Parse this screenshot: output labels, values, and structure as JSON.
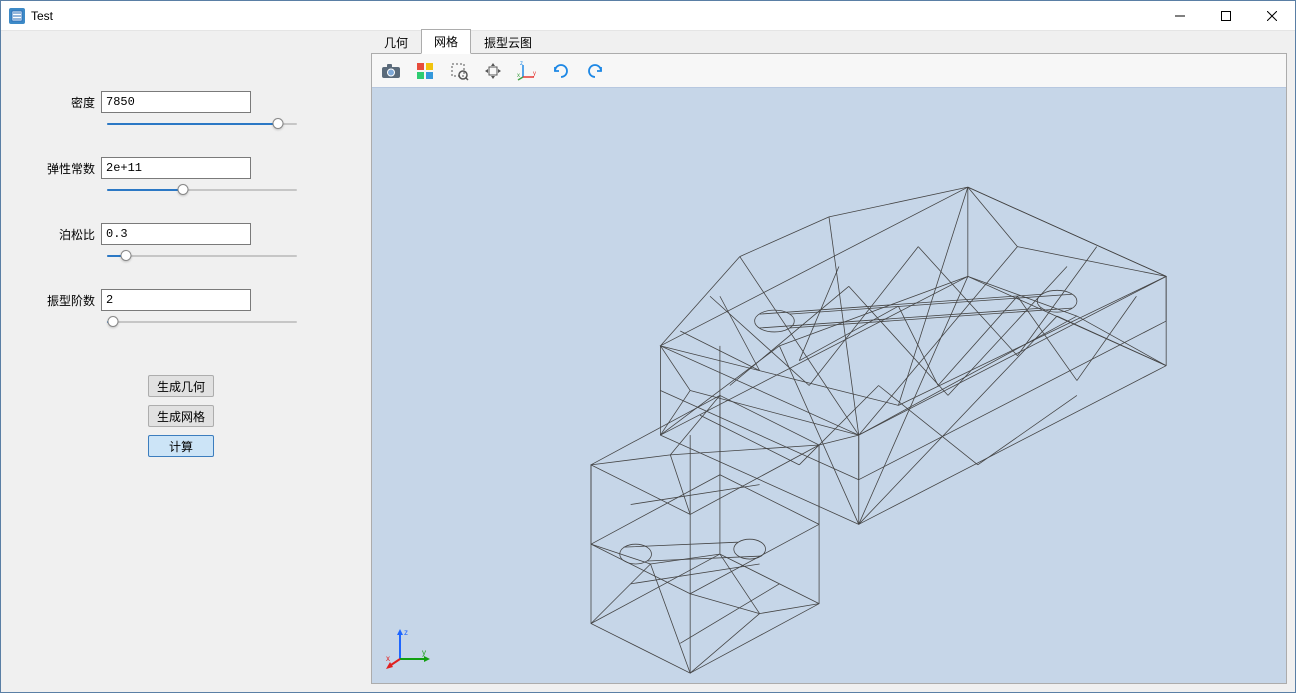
{
  "window": {
    "title": "Test"
  },
  "parameters": [
    {
      "label": "密度",
      "value": "7850",
      "slider_pct": 90
    },
    {
      "label": "弹性常数",
      "value": "2e+11",
      "slider_pct": 40
    },
    {
      "label": "泊松比",
      "value": "0.3",
      "slider_pct": 10
    },
    {
      "label": "振型阶数",
      "value": "2",
      "slider_pct": 3
    }
  ],
  "buttons": {
    "generate_geometry": "生成几何",
    "generate_mesh": "生成网格",
    "compute": "计算"
  },
  "tabs": [
    {
      "label": "几何",
      "active": false
    },
    {
      "label": "网格",
      "active": true
    },
    {
      "label": "振型云图",
      "active": false
    }
  ],
  "toolbar_icons": [
    "camera-icon",
    "palette-icon",
    "zoom-box-icon",
    "pan-icon",
    "xyz-axes-icon",
    "rotate-cw-icon",
    "rotate-ccw-icon"
  ],
  "axis_labels": {
    "x": "x",
    "y": "y",
    "z": "z"
  }
}
